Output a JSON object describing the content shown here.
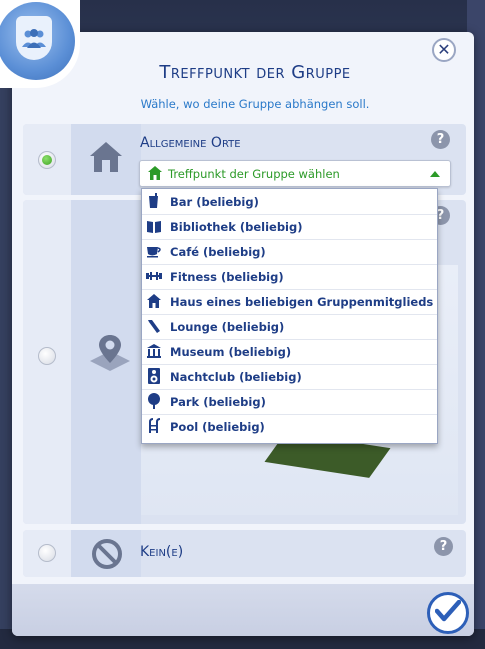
{
  "dialog": {
    "title": "Treffpunkt der Gruppe",
    "subtitle": "Wähle, wo deine Gruppe abhängen soll.",
    "close_glyph": "✕"
  },
  "options": [
    {
      "label": "Allgemeine Orte",
      "selected": true,
      "icon": "house-icon"
    },
    {
      "label": "",
      "selected": false,
      "icon": "map-pin-icon"
    },
    {
      "label": "Kein(e)",
      "selected": false,
      "icon": "prohibited-icon"
    }
  ],
  "dropdown": {
    "selected_label": "Treffpunkt der Gruppe wählen",
    "items": [
      {
        "label": "Bar (beliebig)",
        "icon": "drink-icon"
      },
      {
        "label": "Bibliothek (beliebig)",
        "icon": "book-icon"
      },
      {
        "label": "Café (beliebig)",
        "icon": "coffee-cup-icon"
      },
      {
        "label": "Fitness (beliebig)",
        "icon": "dumbbell-icon"
      },
      {
        "label": "Haus eines beliebigen Gruppenmitglieds",
        "icon": "house-icon"
      },
      {
        "label": "Lounge (beliebig)",
        "icon": "cocktail-icon"
      },
      {
        "label": "Museum (beliebig)",
        "icon": "museum-icon"
      },
      {
        "label": "Nachtclub (beliebig)",
        "icon": "speaker-icon"
      },
      {
        "label": "Park (beliebig)",
        "icon": "tree-icon"
      },
      {
        "label": "Pool (beliebig)",
        "icon": "pool-ladder-icon"
      }
    ]
  },
  "help_glyph": "?",
  "colors": {
    "accent": "#1e3d86",
    "selected_green": "#2c9a28",
    "confirm_blue": "#2d5fb8"
  }
}
